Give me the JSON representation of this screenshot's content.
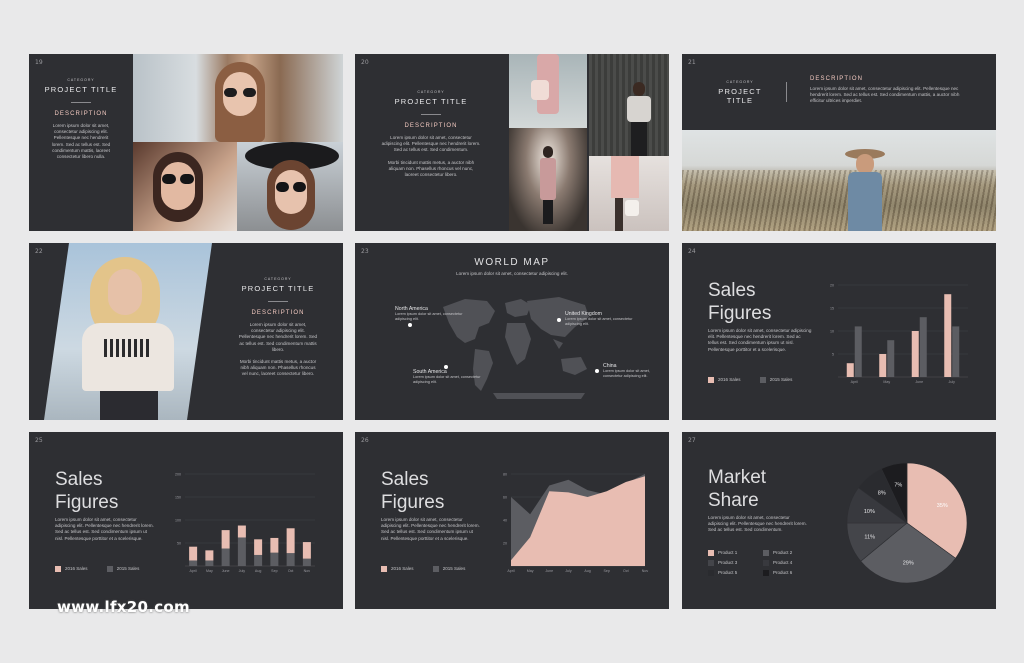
{
  "watermark": "www.lfx20.com",
  "colors": {
    "background": "#e9e9ea",
    "slide": "#2e2f33",
    "accent": "#e8bdb2",
    "gray": "#5c5d62",
    "dark": "#3c3d42"
  },
  "slides": [
    {
      "num": "19",
      "category": "CATEGORY",
      "title": "PROJECT TITLE",
      "desc_heading": "DESCRIPTION",
      "body": "Lorem ipsum dolor sit amet, consectetur adipiscing elit. Pellentesque nec hendrerit lorem. Sed ac tellus est. Sed condimentum mattis, laoreet consectetur libero nulla."
    },
    {
      "num": "20",
      "category": "CATEGORY",
      "title": "PROJECT TITLE",
      "desc_heading": "DESCRIPTION",
      "body1": "Lorem ipsum dolor sit amet, consectetur adipiscing elit. Pellentesque nec hendrerit lorem. Sed ac tellus est. Sed condimentum.",
      "body2": "Morbi tincidunt mattis metus, a auctor nibh aliquam non. Phasellus rhoncus vel nunc, laoreet consectetur libero."
    },
    {
      "num": "21",
      "category": "CATEGORY",
      "title": "PROJECT TITLE",
      "desc_heading": "DESCRIPTION",
      "body": "Lorem ipsum dolor sit amet, consectetur adipiscing elit. Pellentesque nec hendrerit lorem. Sed ac tellus est. Sed condimentum mattis, a auctor nibh efficitur ultrices imperdiet."
    },
    {
      "num": "22",
      "category": "CATEGORY",
      "title": "PROJECT TITLE",
      "desc_heading": "DESCRIPTION",
      "body1": "Lorem ipsum dolor sit amet, consectetur adipiscing elit. Pellentesque nec hendrerit lorem. Sed ac tellus est. Sed condimentum mattis libero.",
      "body2": "Morbi tincidunt mattis metus, a auctor nibh aliquam non. Phasellus rhoncus vel nunc, laoreet consectetur libero."
    },
    {
      "num": "23",
      "title": "WORLD MAP",
      "subtitle": "Lorem ipsum dolor sit amet, consectetur adipiscing elit.",
      "labels": [
        {
          "name": "North America",
          "text": "Lorem ipsum dolor sit amet, consectetur adipiscing elit."
        },
        {
          "name": "United Kingdom",
          "text": "Lorem ipsum dolor sit amet, consectetur adipiscing elit."
        },
        {
          "name": "South America",
          "text": "Lorem ipsum dolor sit amet, consectetur adipiscing elit."
        },
        {
          "name": "China",
          "text": "Lorem ipsum dolor sit amet, consectetur adipiscing elit."
        }
      ]
    },
    {
      "num": "24",
      "title_l1": "Sales",
      "title_l2": "Figures",
      "body": "Lorem ipsum dolor sit amet, consectetur adipiscing elit. Pellentesque nec hendrerit lorem. Sed ac tellus est. Sed condimentum ipsum ut nisl. Pellentesque porttitor et a scelerisque.",
      "legend": [
        "2016 Sales",
        "2015 Sales"
      ]
    },
    {
      "num": "25",
      "title_l1": "Sales",
      "title_l2": "Figures",
      "body": "Lorem ipsum dolor sit amet, consectetur adipiscing elit. Pellentesque nec hendrerit lorem. Sed ac tellus est. Sed condimentum ipsum ut nisl. Pellentesque porttitor et a scelerisque.",
      "legend": [
        "2016 Sales",
        "2015 Sales"
      ]
    },
    {
      "num": "26",
      "title_l1": "Sales",
      "title_l2": "Figures",
      "body": "Lorem ipsum dolor sit amet, consectetur adipiscing elit. Pellentesque nec hendrerit lorem. Sed ac tellus est. Sed condimentum ipsum ut nisl. Pellentesque porttitor et a scelerisque.",
      "legend": [
        "2016 Sales",
        "2015 Sales"
      ]
    },
    {
      "num": "27",
      "title_l1": "Market",
      "title_l2": "Share",
      "body": "Lorem ipsum dolor sit amet, consectetur adipiscing elit. Pellentesque nec hendrerit lorem. Sed ac tellus est. Sed condimentum.",
      "legend": [
        "Product 1",
        "Product 2",
        "Product 3",
        "Product 4",
        "Product 5",
        "Product 6"
      ]
    }
  ],
  "chart_data": [
    {
      "type": "bar",
      "slide": "24",
      "categories": [
        "April",
        "May",
        "June",
        "July"
      ],
      "series": [
        {
          "name": "2016 Sales",
          "values": [
            3,
            5,
            10,
            18
          ]
        },
        {
          "name": "2015 Sales",
          "values": [
            11,
            8,
            13,
            11
          ]
        }
      ],
      "yticks": [
        "20",
        "15",
        "10",
        "5"
      ],
      "ylim": [
        0,
        20
      ]
    },
    {
      "type": "bar",
      "slide": "25",
      "categories": [
        "April",
        "May",
        "June",
        "July",
        "Aug",
        "Sep",
        "Oct",
        "Nov"
      ],
      "series": [
        {
          "name": "2016 Sales",
          "values": [
            30,
            22,
            40,
            26,
            34,
            32,
            54,
            36
          ]
        },
        {
          "name": "2015 Sales",
          "values": [
            12,
            12,
            38,
            62,
            24,
            29,
            28,
            16
          ]
        }
      ],
      "yticks": [
        "200",
        "150",
        "100",
        "50"
      ],
      "ylim": [
        0,
        200
      ],
      "stacked": true
    },
    {
      "type": "area",
      "slide": "26",
      "categories": [
        "April",
        "May",
        "June",
        "July",
        "Aug",
        "Sep",
        "Oct",
        "Nov"
      ],
      "series": [
        {
          "name": "2015 Sales",
          "values": [
            60,
            45,
            70,
            75,
            66,
            62,
            72,
            80
          ]
        },
        {
          "name": "2016 Sales",
          "values": [
            5,
            25,
            65,
            64,
            60,
            65,
            73,
            78
          ]
        }
      ],
      "yticks": [
        "80",
        "60",
        "40",
        "20"
      ],
      "ylim": [
        0,
        80
      ]
    },
    {
      "type": "pie",
      "slide": "27",
      "labels": [
        "35%",
        "29%",
        "11%",
        "10%",
        "8%",
        "7%"
      ],
      "values": [
        35,
        29,
        11,
        10,
        8,
        7
      ]
    }
  ]
}
